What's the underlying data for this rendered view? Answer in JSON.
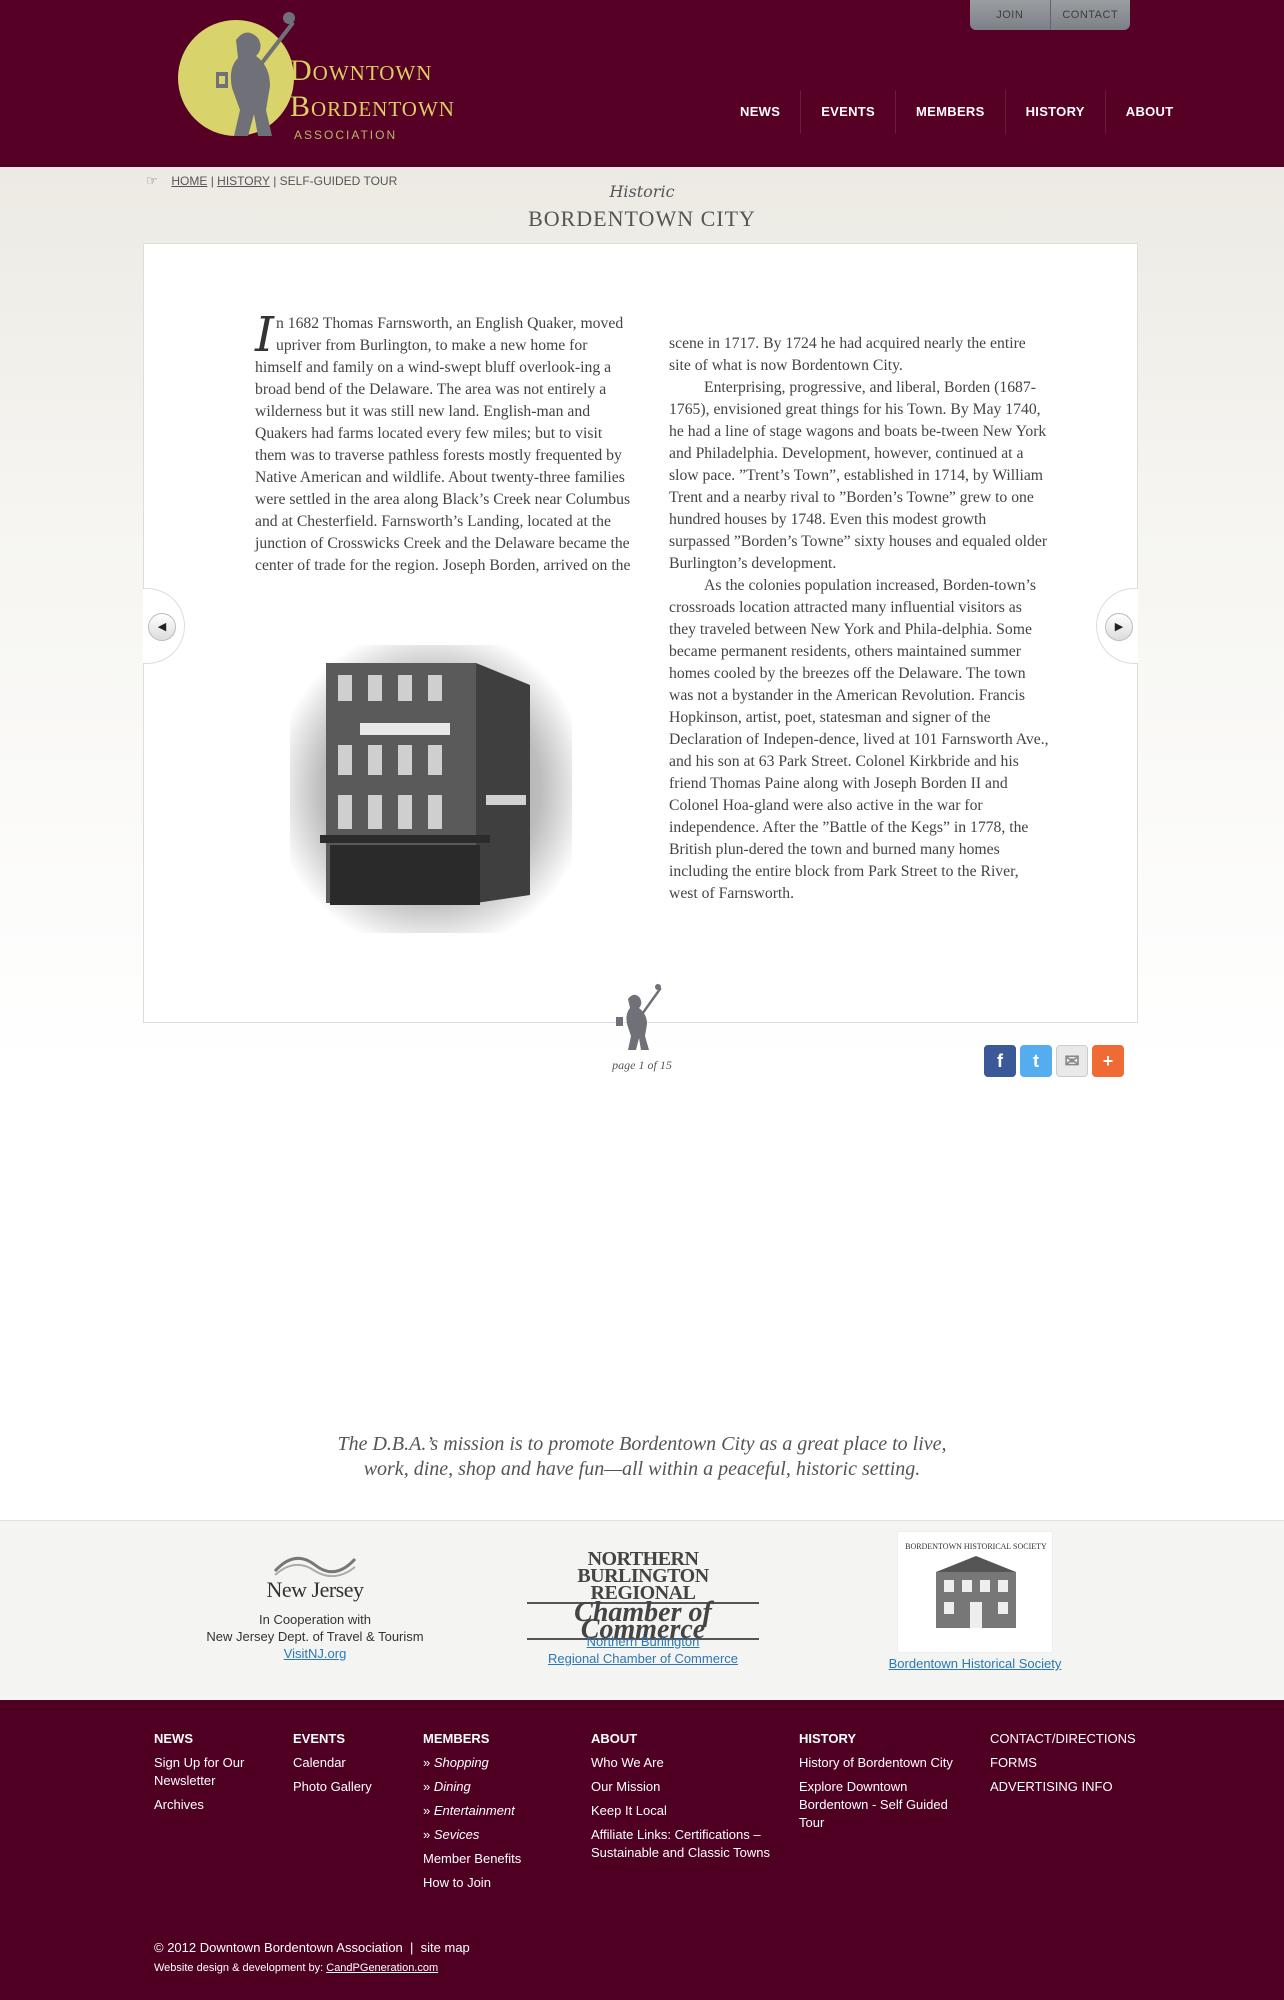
{
  "header": {
    "logo": {
      "line1": "Downtown",
      "line2": "Bordentown",
      "line3": "ASSOCIATION"
    },
    "top_links": [
      "JOIN",
      "CONTACT"
    ],
    "nav": [
      "NEWS",
      "EVENTS",
      "MEMBERS",
      "HISTORY",
      "ABOUT"
    ]
  },
  "breadcrumb": {
    "home": "HOME",
    "sep1": "|",
    "history": "HISTORY",
    "sep2": "|",
    "current": "SELF-GUIDED TOUR"
  },
  "page_title": {
    "script": "Historic",
    "main": "BORDENTOWN CITY"
  },
  "article": {
    "dropcap": "I",
    "col1_p1": "n 1682 Thomas Farnsworth, an English Quaker, moved upriver from Burlington, to make a new home for himself and family on a wind-swept bluff overlook-ing a broad bend of the Delaware. The area was not entirely a wilderness but it was still new land. English-man and Quakers had farms located every few miles; but to visit them was to traverse pathless forests mostly frequented by Native American and wildlife. About twenty-three families were settled in the area along Black’s Creek near Columbus and at Chesterfield. Farnsworth’s Landing, located at the junction of Crosswicks Creek and the Delaware became the center of trade for the region. Joseph Borden, arrived on the",
    "col2_p1": "scene in 1717. By 1724 he had acquired nearly the entire site of what is now Bordentown City.",
    "col2_p2": "Enterprising, progressive, and liberal, Borden (1687-1765), envisioned great things for his Town. By May 1740, he had a line of stage wagons and boats be-tween New York and Philadelphia. Development, however, continued at a slow pace. ”Trent’s Town”, established in 1714, by William Trent and a nearby rival to ”Borden’s Towne” grew to one hundred houses by 1748. Even this modest growth surpassed ”Borden’s Towne” sixty houses and equaled older Burlington’s development.",
    "col2_p3": "As the colonies population increased, Borden-town’s crossroads location attracted many influential visitors as they traveled between New York and Phila-delphia. Some became permanent residents, others maintained summer homes cooled by the breezes off the Delaware. The town was not a bystander in the American Revolution. Francis Hopkinson, artist, poet, statesman and signer of the Declaration of Indepen-dence, lived at 101 Farnsworth Ave., and his son at 63 Park Street. Colonel Kirkbride and his friend Thomas Paine along with Joseph Borden II and Colonel Hoa-gland were also active in the war for independence. After the ”Battle of the Kegs” in 1778, the British plun-dered the town and burned many homes including the entire block from Park Street to the River, west of Farnsworth."
  },
  "pagination": {
    "text": "page 1 of 15",
    "prev_icon": "arrow-left-icon",
    "next_icon": "arrow-right-icon"
  },
  "share": {
    "facebook": "f",
    "twitter": "t",
    "email": "✉",
    "more": "+"
  },
  "mission": {
    "line1": "The D.B.A.’s mission is to promote Bordentown City as a great place to live,",
    "line2": "work, dine, shop and have fun—all within a peaceful, historic setting."
  },
  "partners": {
    "nj": {
      "logo_text": "New Jersey",
      "line1": "In Cooperation with",
      "line2": "New Jersey Dept. of Travel & Tourism",
      "link": "VisitNJ.org"
    },
    "chamber": {
      "logo_line1": "NORTHERN BURLINGTON REGIONAL",
      "logo_line2": "Chamber of Commerce",
      "link1": "Northern Burlington",
      "link2": "Regional Chamber of Commerce"
    },
    "historical": {
      "logo_text": "BORDENTOWN HISTORICAL SOCIETY",
      "link": "Bordentown Historical Society"
    }
  },
  "footer": {
    "news": {
      "title": "NEWS",
      "items": [
        "Sign Up for Our Newsletter",
        "Archives"
      ]
    },
    "events": {
      "title": "EVENTS",
      "items": [
        "Calendar",
        "Photo Gallery"
      ]
    },
    "members": {
      "title": "MEMBERS",
      "subitems": [
        "Shopping",
        "Dining",
        "Entertainment",
        "Sevices"
      ],
      "items": [
        "Member Benefits",
        "How to Join"
      ]
    },
    "about": {
      "title": "ABOUT",
      "items": [
        "Who We Are",
        "Our Mission",
        "Keep It Local",
        "Affiliate Links: Certifications – Sustainable and Classic Towns"
      ]
    },
    "history": {
      "title": "HISTORY",
      "items": [
        "History of Bordentown City",
        "Explore Downtown Bordentown - Self Guided Tour"
      ]
    },
    "contact": {
      "items": [
        "CONTACT/DIRECTIONS",
        "FORMS",
        "ADVERTISING INFO"
      ]
    },
    "copyright": "© 2012 Downtown Bordentown Association",
    "sitemap_sep": "|",
    "sitemap": "site map",
    "credits_label": "Website design & development by:",
    "credits_link": "CandPGeneration.com"
  },
  "colors": {
    "header_bg": "#560026",
    "footer_bg": "#4f0022",
    "logo_yellow": "#d9d36b",
    "link_blue": "#2a78b8"
  }
}
